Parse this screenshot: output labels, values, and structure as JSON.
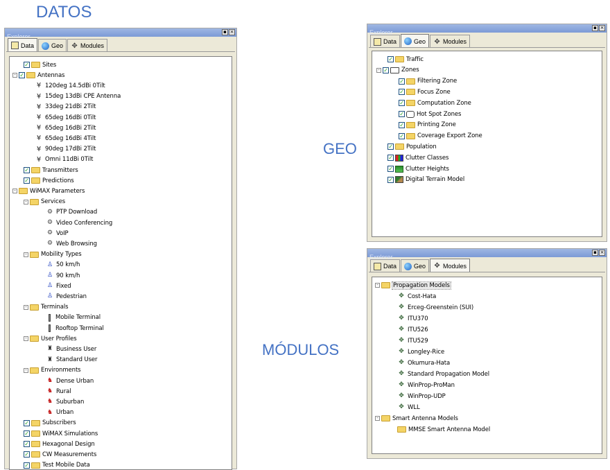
{
  "captions": {
    "datos": "DATOS",
    "geo": "GEO",
    "modulos": "MÓDULOS"
  },
  "explorer_title": "Explorer",
  "tabs": {
    "data": "Data",
    "geo": "Geo",
    "modules": "Modules"
  },
  "colors": {
    "caption": "#4472c4",
    "folder": "#f4d466",
    "titlebar": "#7c9ad6"
  },
  "data_tree": [
    {
      "label": "Sites",
      "depth": 1,
      "icon": "folder-icon",
      "check": true
    },
    {
      "label": "Antennas",
      "depth": 0,
      "icon": "folder-icon",
      "check": true,
      "expand": "-"
    },
    {
      "label": "120deg 14.5dBi 0Tilt",
      "depth": 2,
      "icon": "antenna-icon"
    },
    {
      "label": "15deg 13dBi CPE Antenna",
      "depth": 2,
      "icon": "antenna-icon"
    },
    {
      "label": "33deg 21dBi 2Tilt",
      "depth": 2,
      "icon": "antenna-icon"
    },
    {
      "label": "65deg 16dBi 0Tilt",
      "depth": 2,
      "icon": "antenna-icon"
    },
    {
      "label": "65deg 16dBi 2Tilt",
      "depth": 2,
      "icon": "antenna-icon"
    },
    {
      "label": "65deg 16dBi 4Tilt",
      "depth": 2,
      "icon": "antenna-icon"
    },
    {
      "label": "90deg 17dBi 2Tilt",
      "depth": 2,
      "icon": "antenna-icon"
    },
    {
      "label": "Omni 11dBi 0Tilt",
      "depth": 2,
      "icon": "antenna-icon"
    },
    {
      "label": "Transmitters",
      "depth": 1,
      "icon": "folder-icon",
      "check": true
    },
    {
      "label": "Predictions",
      "depth": 1,
      "icon": "folder-icon",
      "check": true
    },
    {
      "label": "WiMAX Parameters",
      "depth": 0,
      "icon": "folder-icon",
      "expand": "-"
    },
    {
      "label": "Services",
      "depth": 1,
      "icon": "folder-icon",
      "expand": "-"
    },
    {
      "label": "PTP Download",
      "depth": 3,
      "icon": "service-icon"
    },
    {
      "label": "Video Conferencing",
      "depth": 3,
      "icon": "service-icon"
    },
    {
      "label": "VoIP",
      "depth": 3,
      "icon": "service-icon"
    },
    {
      "label": "Web Browsing",
      "depth": 3,
      "icon": "service-icon"
    },
    {
      "label": "Mobility Types",
      "depth": 1,
      "icon": "folder-icon",
      "expand": "-"
    },
    {
      "label": "50 km/h",
      "depth": 3,
      "icon": "mobility-icon"
    },
    {
      "label": "90 km/h",
      "depth": 3,
      "icon": "mobility-icon"
    },
    {
      "label": "Fixed",
      "depth": 3,
      "icon": "mobility-icon"
    },
    {
      "label": "Pedestrian",
      "depth": 3,
      "icon": "mobility-icon"
    },
    {
      "label": "Terminals",
      "depth": 1,
      "icon": "folder-icon",
      "expand": "-"
    },
    {
      "label": "Mobile Terminal",
      "depth": 3,
      "icon": "terminal-icon"
    },
    {
      "label": "Rooftop Terminal",
      "depth": 3,
      "icon": "terminal-icon"
    },
    {
      "label": "User Profiles",
      "depth": 1,
      "icon": "folder-icon",
      "expand": "-"
    },
    {
      "label": "Business User",
      "depth": 3,
      "icon": "user-profile-icon"
    },
    {
      "label": "Standard User",
      "depth": 3,
      "icon": "user-profile-icon"
    },
    {
      "label": "Environments",
      "depth": 1,
      "icon": "folder-icon",
      "expand": "-"
    },
    {
      "label": "Dense Urban",
      "depth": 3,
      "icon": "environment-icon"
    },
    {
      "label": "Rural",
      "depth": 3,
      "icon": "environment-icon"
    },
    {
      "label": "Suburban",
      "depth": 3,
      "icon": "environment-icon"
    },
    {
      "label": "Urban",
      "depth": 3,
      "icon": "environment-icon"
    },
    {
      "label": "Subscribers",
      "depth": 1,
      "icon": "folder-icon",
      "check": true
    },
    {
      "label": "WiMAX Simulations",
      "depth": 1,
      "icon": "folder-icon",
      "check": true
    },
    {
      "label": "Hexagonal Design",
      "depth": 1,
      "icon": "folder-icon",
      "check": true
    },
    {
      "label": "CW Measurements",
      "depth": 1,
      "icon": "folder-icon",
      "check": true
    },
    {
      "label": "Test Mobile Data",
      "depth": 1,
      "icon": "folder-icon",
      "check": true
    }
  ],
  "geo_tree": [
    {
      "label": "Traffic",
      "depth": 1,
      "icon": "folder-icon",
      "check": true
    },
    {
      "label": "Zones",
      "depth": 0,
      "icon": "zones-icon",
      "check": true,
      "expand": "-"
    },
    {
      "label": "Filtering Zone",
      "depth": 2,
      "icon": "folder-icon",
      "check": true
    },
    {
      "label": "Focus Zone",
      "depth": 2,
      "icon": "folder-icon",
      "check": true
    },
    {
      "label": "Computation Zone",
      "depth": 2,
      "icon": "folder-icon",
      "check": true
    },
    {
      "label": "Hot Spot Zones",
      "depth": 2,
      "icon": "hotspot-icon",
      "check": true
    },
    {
      "label": "Printing Zone",
      "depth": 2,
      "icon": "folder-icon",
      "check": true
    },
    {
      "label": "Coverage Export Zone",
      "depth": 2,
      "icon": "folder-icon",
      "check": true
    },
    {
      "label": "Population",
      "depth": 1,
      "icon": "folder-icon",
      "check": true
    },
    {
      "label": "Clutter Classes",
      "depth": 1,
      "icon": "clutter-icon",
      "check": true
    },
    {
      "label": "Clutter Heights",
      "depth": 1,
      "icon": "terrain-icon",
      "check": true
    },
    {
      "label": "Digital Terrain Model",
      "depth": 1,
      "icon": "dtm-icon",
      "check": true
    }
  ],
  "modules_tree": [
    {
      "label": "Propagation Models",
      "depth": 0,
      "icon": "folder-icon",
      "expand": "-",
      "selected": true
    },
    {
      "label": "Cost-Hata",
      "depth": 2,
      "icon": "module-icon"
    },
    {
      "label": "Erceg-Greenstein (SUI)",
      "depth": 2,
      "icon": "module-icon"
    },
    {
      "label": "ITU370",
      "depth": 2,
      "icon": "module-icon"
    },
    {
      "label": "ITU526",
      "depth": 2,
      "icon": "module-icon"
    },
    {
      "label": "ITU529",
      "depth": 2,
      "icon": "module-icon"
    },
    {
      "label": "Longley-Rice",
      "depth": 2,
      "icon": "module-icon"
    },
    {
      "label": "Okumura-Hata",
      "depth": 2,
      "icon": "module-icon"
    },
    {
      "label": "Standard Propagation Model",
      "depth": 2,
      "icon": "module-icon"
    },
    {
      "label": "WinProp-ProMan",
      "depth": 2,
      "icon": "module-icon"
    },
    {
      "label": "WinProp-UDP",
      "depth": 2,
      "icon": "module-icon"
    },
    {
      "label": "WLL",
      "depth": 2,
      "icon": "module-icon"
    },
    {
      "label": "Smart Antenna Models",
      "depth": 0,
      "icon": "folder-icon",
      "expand": "-"
    },
    {
      "label": "MMSE Smart Antenna Model",
      "depth": 2,
      "icon": "folder-icon"
    }
  ]
}
